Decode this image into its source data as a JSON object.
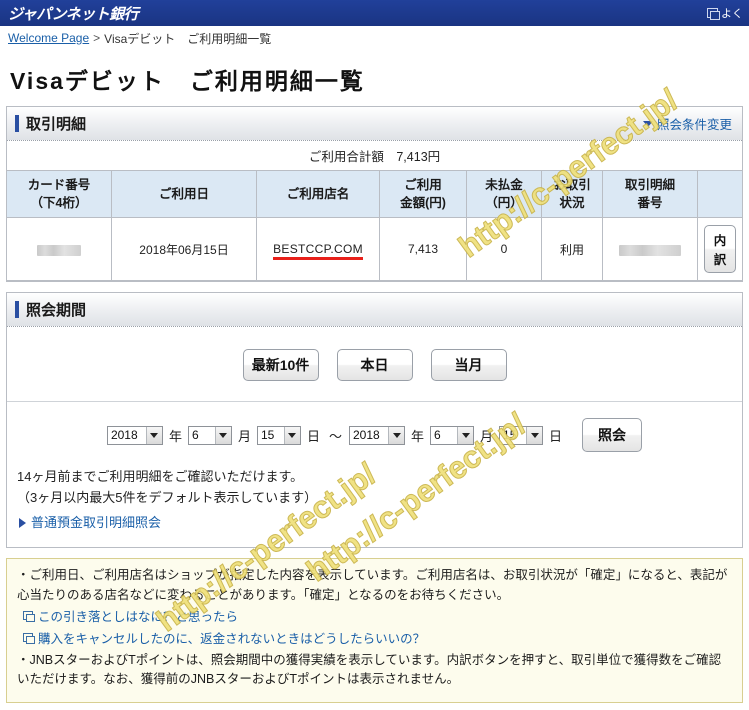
{
  "topbar": {
    "brand": "ジャパンネット銀行",
    "right_link": "よく",
    "right_icon": "external-window-icon"
  },
  "breadcrumb": {
    "home": "Welcome Page",
    "separator": ">",
    "current": "Visaデビット　ご利用明細一覧"
  },
  "page_title": "Visaデビット　ご利用明細一覧",
  "transaction_panel": {
    "title": "取引明細",
    "change_conditions_link": "照会条件変更",
    "total_label": "ご利用合計額",
    "total_value": "7,413円",
    "total_line": "ご利用合計額　7,413円",
    "columns": [
      "カード番号\n（下4桁）",
      "ご利用日",
      "ご利用店名",
      "ご利用\n金額(円)",
      "未払金\n（円）",
      "お取引\n状況",
      "取引明細\n番号",
      ""
    ],
    "columns_flat": {
      "card_no": "カード番号",
      "card_no_sub": "（下4桁）",
      "use_date": "ご利用日",
      "shop_name": "ご利用店名",
      "amount": "ご利用",
      "amount_sub": "金額(円)",
      "unpaid": "未払金",
      "unpaid_sub": "（円）",
      "status": "お取引",
      "status_sub": "状況",
      "txn_no": "取引明細",
      "txn_no_sub": "番号"
    },
    "rows": [
      {
        "card_no": "",
        "card_no_masked": true,
        "use_date": "2018年06月15日",
        "shop_name": "BESTCCP.COM",
        "shop_name_highlight_color": "#e8201a",
        "amount": "7,413",
        "unpaid": "0",
        "status": "利用",
        "txn_no": "",
        "txn_no_masked": true,
        "detail_button": "内訳"
      }
    ]
  },
  "period_panel": {
    "title": "照会期間",
    "quick_buttons": [
      "最新10件",
      "本日",
      "当月"
    ],
    "date_from": {
      "year": "2018",
      "year_unit": "年",
      "month": "6",
      "month_unit": "月",
      "day": "15",
      "day_unit": "日"
    },
    "range_separator": "〜",
    "date_to": {
      "year": "2018",
      "year_unit": "年",
      "month": "6",
      "month_unit": "月",
      "day": "15",
      "day_unit": "日"
    },
    "query_button": "照会",
    "note_line1": "14ヶ月前までご利用明細をご確認いただけます。",
    "note_line2": "（3ヶ月以内最大5件をデフォルト表示しています）",
    "savings_link": "普通預金取引明細照会"
  },
  "notice": {
    "bullet1": "・ご利用日、ご利用店名はショップが指定した内容を表示しています。ご利用店名は、お取引状況が「確定」になると、表記が心当たりのある店名などに変わることがあります。「確定」となるのをお待ちください。",
    "link1": "この引き落としはなに？と思ったら",
    "link2": "購入をキャンセルしたのに、返金されないときはどうしたらいいの？",
    "bullet2": "・JNBスターおよびTポイントは、照会期間中の獲得実績を表示しています。内訳ボタンを押すと、取引単位で獲得数をご確認いただけます。なお、獲得前のJNBスターおよびTポイントは表示されません。"
  },
  "watermark": {
    "text1": "http://c-perfect.jp/",
    "text2": "http://c-perfect.jp/",
    "text3": "http://c-perfect.jp/",
    "color": "#efe07a"
  },
  "colors": {
    "header_blue": "#1b3a8c",
    "accent_blue": "#2a4fa2",
    "link_blue": "#1a5fa8",
    "table_header_bg": "#dbe8f4",
    "notice_bg": "#fdfced",
    "notice_border": "#d8cf90",
    "highlight_red": "#e8201a"
  }
}
